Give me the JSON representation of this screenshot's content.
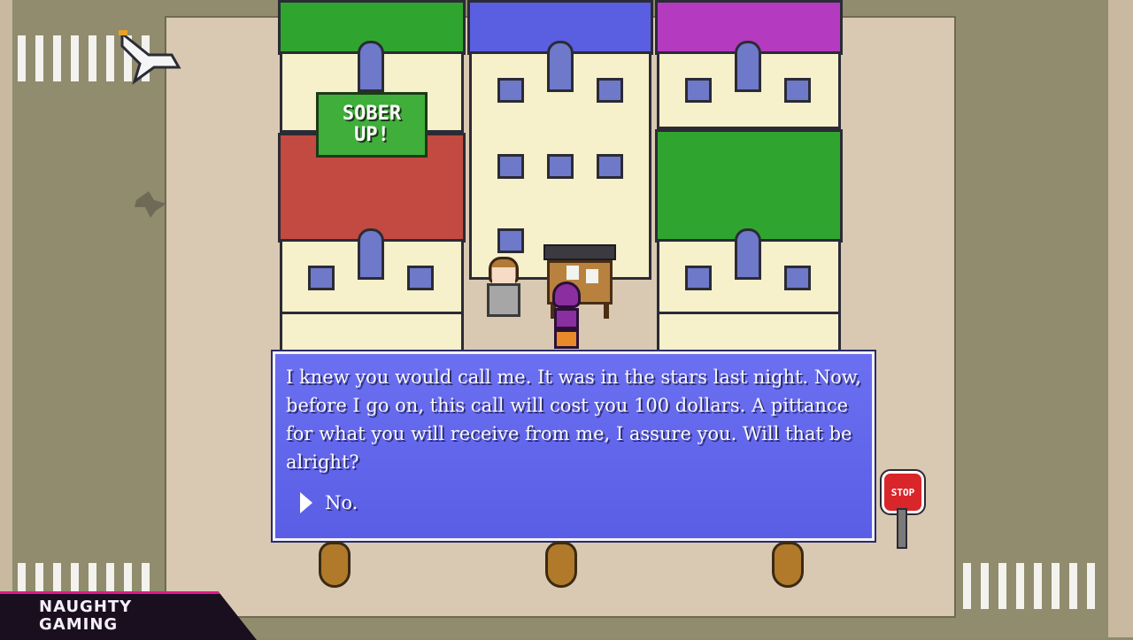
{
  "sign": {
    "line1": "SOBER",
    "line2": "UP!"
  },
  "dialog": {
    "text": "I knew you would call me. It was in the stars last night. Now, before I go on, this call will cost you 100 dollars. A pittance for what you will receive from me, I assure you. Will that be alright?",
    "choice": "No."
  },
  "stop_sign": {
    "label": "STOP"
  },
  "logo": {
    "line1": "NAUGHTY",
    "line2": "GAMING"
  },
  "colors": {
    "dialog_bg": "#5a5ee6",
    "roof_green": "#2fa52f",
    "roof_blue": "#5a5ee0",
    "roof_purple": "#b43ac0",
    "roof_red": "#c24a40",
    "logo_accent": "#e0198a"
  }
}
